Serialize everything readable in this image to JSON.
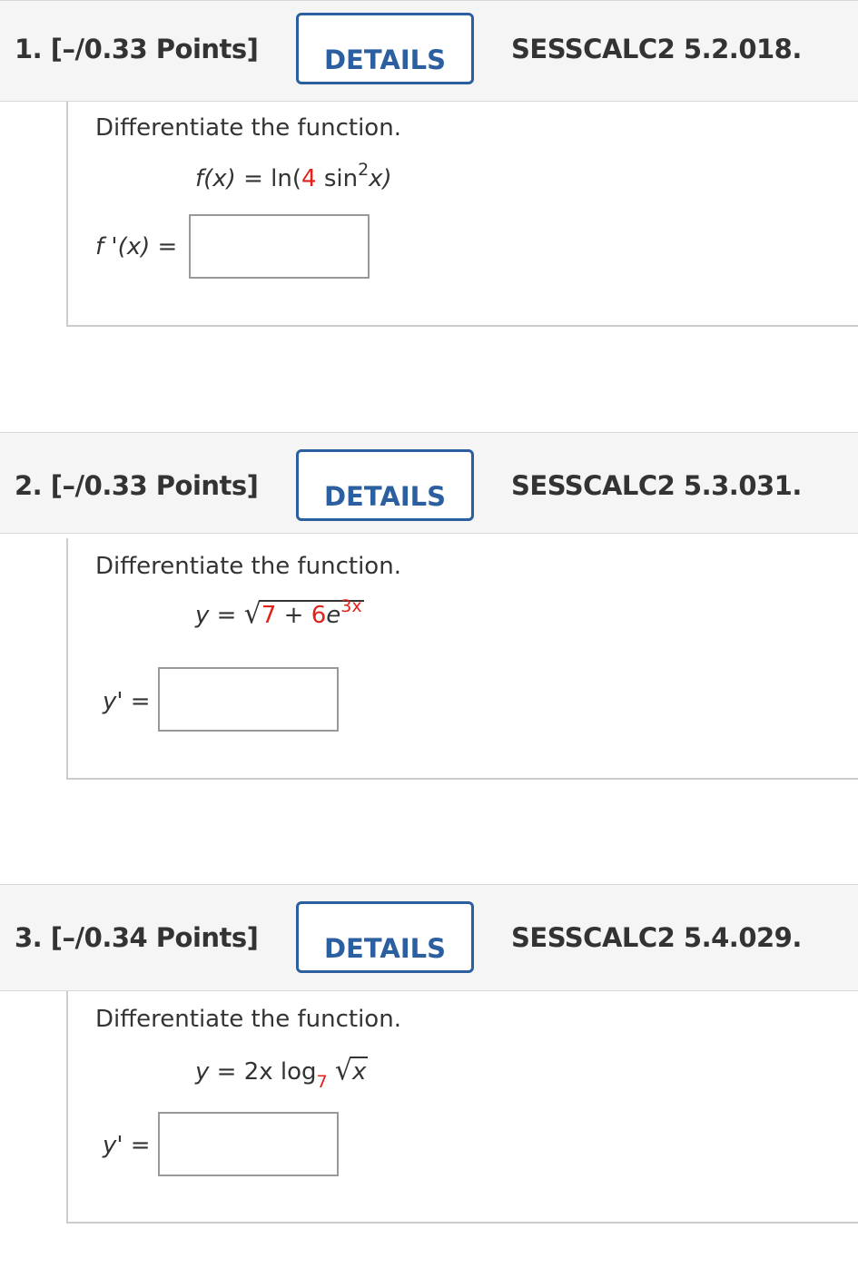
{
  "questions": [
    {
      "number_points": "1. [–/0.33 Points]",
      "details_label": "DETAILS",
      "code": "SESSCALC2 5.2.018.",
      "prompt": "Differentiate the function.",
      "eq": {
        "lhs": "f(x)",
        "eqsign": "=",
        "fn": "ln(",
        "coef": "4",
        "trig": "sin",
        "exp": "2",
        "var": "x)"
      },
      "answer_label": "f '(x) =",
      "answer_value": ""
    },
    {
      "number_points": "2. [–/0.33 Points]",
      "details_label": "DETAILS",
      "code": "SESSCALC2 5.3.031.",
      "prompt": "Differentiate the function.",
      "eq": {
        "lhs": "y",
        "eqsign": "=",
        "a": "7",
        "plus": "+",
        "b": "6",
        "base": "e",
        "exp": "3x"
      },
      "answer_label": "y' =",
      "answer_value": ""
    },
    {
      "number_points": "3. [–/0.34 Points]",
      "details_label": "DETAILS",
      "code": "SESSCALC2 5.4.029.",
      "prompt": "Differentiate the function.",
      "eq": {
        "lhs": "y",
        "eqsign": "=",
        "coef": "2x",
        "log": "log",
        "base": "7",
        "radicand": "x"
      },
      "answer_label": "y' =",
      "answer_value": ""
    }
  ],
  "colors": {
    "accent": "#2b5fa0",
    "highlight": "#e0221b",
    "header_bg": "#f5f5f5"
  }
}
